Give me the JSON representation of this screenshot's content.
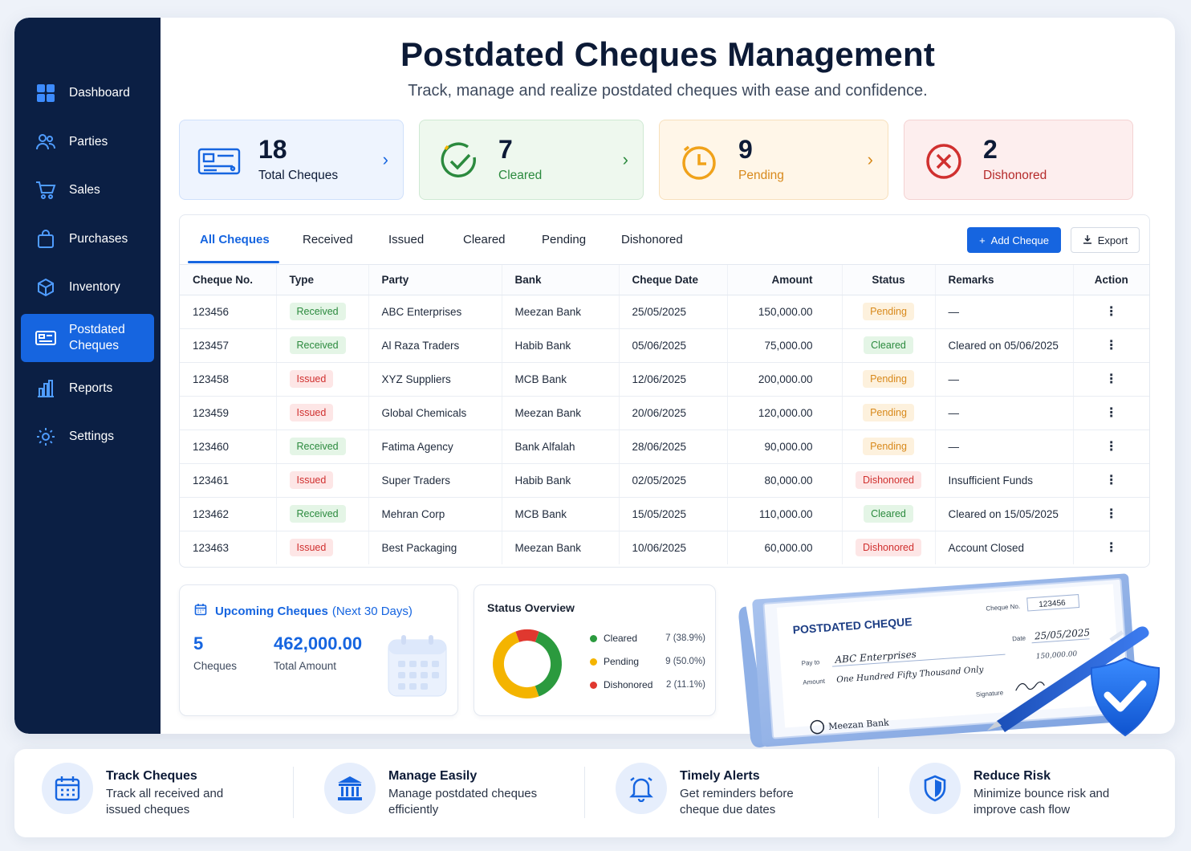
{
  "sidebar": {
    "items": [
      {
        "label": "Dashboard",
        "icon": "dashboard-icon"
      },
      {
        "label": "Parties",
        "icon": "users-icon"
      },
      {
        "label": "Sales",
        "icon": "cart-icon"
      },
      {
        "label": "Purchases",
        "icon": "bag-icon"
      },
      {
        "label": "Inventory",
        "icon": "box-icon"
      },
      {
        "label": "Postdated Cheques",
        "icon": "cheque-icon",
        "active": true
      },
      {
        "label": "Reports",
        "icon": "bar-chart-icon"
      },
      {
        "label": "Settings",
        "icon": "gear-icon"
      }
    ]
  },
  "header": {
    "title": "Postdated Cheques Management",
    "subtitle": "Track, manage and realize postdated cheques with ease and confidence."
  },
  "stats": [
    {
      "value": "18",
      "label": "Total Cheques",
      "color": "#1665e0"
    },
    {
      "value": "7",
      "label": "Cleared",
      "color": "#2b8a3e"
    },
    {
      "value": "9",
      "label": "Pending",
      "color": "#d8891b"
    },
    {
      "value": "2",
      "label": "Dishonored",
      "color": "#d0302f"
    }
  ],
  "tabs": [
    "All Cheques",
    "Received",
    "Issued",
    "Cleared",
    "Pending",
    "Dishonored"
  ],
  "actions": {
    "add": "Add Cheque",
    "export": "Export"
  },
  "table": {
    "columns": [
      "Cheque No.",
      "Type",
      "Party",
      "Bank",
      "Cheque Date",
      "Amount",
      "Status",
      "Remarks",
      "Action"
    ],
    "rows": [
      {
        "no": "123456",
        "type": "Received",
        "party": "ABC Enterprises",
        "bank": "Meezan Bank",
        "date": "25/05/2025",
        "amount": "150,000.00",
        "status": "Pending",
        "remarks": "—"
      },
      {
        "no": "123457",
        "type": "Received",
        "party": "Al Raza Traders",
        "bank": "Habib Bank",
        "date": "05/06/2025",
        "amount": "75,000.00",
        "status": "Cleared",
        "remarks": "Cleared on 05/06/2025"
      },
      {
        "no": "123458",
        "type": "Issued",
        "party": "XYZ Suppliers",
        "bank": "MCB Bank",
        "date": "12/06/2025",
        "amount": "200,000.00",
        "status": "Pending",
        "remarks": "—"
      },
      {
        "no": "123459",
        "type": "Issued",
        "party": "Global Chemicals",
        "bank": "Meezan Bank",
        "date": "20/06/2025",
        "amount": "120,000.00",
        "status": "Pending",
        "remarks": "—"
      },
      {
        "no": "123460",
        "type": "Received",
        "party": "Fatima Agency",
        "bank": "Bank Alfalah",
        "date": "28/06/2025",
        "amount": "90,000.00",
        "status": "Pending",
        "remarks": "—"
      },
      {
        "no": "123461",
        "type": "Issued",
        "party": "Super Traders",
        "bank": "Habib Bank",
        "date": "02/05/2025",
        "amount": "80,000.00",
        "status": "Dishonored",
        "remarks": "Insufficient Funds"
      },
      {
        "no": "123462",
        "type": "Received",
        "party": "Mehran Corp",
        "bank": "MCB Bank",
        "date": "15/05/2025",
        "amount": "110,000.00",
        "status": "Cleared",
        "remarks": "Cleared on 15/05/2025"
      },
      {
        "no": "123463",
        "type": "Issued",
        "party": "Best Packaging",
        "bank": "Meezan Bank",
        "date": "10/06/2025",
        "amount": "60,000.00",
        "status": "Dishonored",
        "remarks": "Account Closed"
      }
    ]
  },
  "upcoming": {
    "title": "Upcoming Cheques",
    "period": "(Next 30 Days)",
    "count": "5",
    "count_label": "Cheques",
    "amount": "462,000.00",
    "amount_label": "Total Amount"
  },
  "overview": {
    "title": "Status Overview",
    "items": [
      {
        "label": "Cleared",
        "value": "7 (38.9%)",
        "fraction": 0.389,
        "color": "#2b9a3e"
      },
      {
        "label": "Pending",
        "value": "9 (50.0%)",
        "fraction": 0.5,
        "color": "#f4b400"
      },
      {
        "label": "Dishonored",
        "value": "2 (11.1%)",
        "fraction": 0.111,
        "color": "#e0382f"
      }
    ]
  },
  "cheque": {
    "heading": "POSTDATED CHEQUE",
    "no_label": "Cheque No.",
    "no": "123456",
    "date_label": "Date",
    "date": "25/05/2025",
    "payto_label": "Pay to",
    "payto": "ABC Enterprises",
    "amount_label": "Amount",
    "amount_words": "One Hundred Fifty Thousand Only",
    "amount": "150,000.00",
    "signature_label": "Signature",
    "bank": "Meezan Bank"
  },
  "features": [
    {
      "title": "Track Cheques",
      "desc": "Track all received and issued cheques",
      "icon": "calendar-icon"
    },
    {
      "title": "Manage Easily",
      "desc": "Manage postdated cheques efficiently",
      "icon": "bank-icon"
    },
    {
      "title": "Timely Alerts",
      "desc": "Get reminders before cheque due dates",
      "icon": "bell-icon"
    },
    {
      "title": "Reduce Risk",
      "desc": "Minimize bounce risk and improve cash flow",
      "icon": "shield-icon"
    }
  ]
}
